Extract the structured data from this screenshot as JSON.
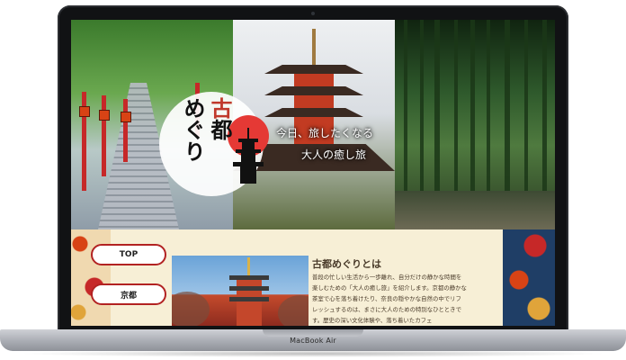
{
  "device": {
    "brand": "MacBook Air"
  },
  "hero": {
    "logo_text": {
      "line1_red": "古",
      "line1": "都",
      "line2": "めぐり"
    },
    "tagline": {
      "line1": "今日、旅したくなる",
      "line2": "大人の癒し旅"
    }
  },
  "nav": {
    "items": [
      {
        "label": "TOP"
      },
      {
        "label": "京都"
      }
    ]
  },
  "about": {
    "title": "古都めぐりとは",
    "text": "普段の忙しい生活から一歩離れ、自分だけの静かな時間を楽しむための「大人の癒し旅」を紹介します。京都の静かな茶室で心を落ち着けたり、奈良の穏やかな自然の中でリフレッシュするのは、まさに大人のための特別なひとときです。歴史の深い文化体験や、落ち着いたカフェ"
  },
  "colors": {
    "accent_red": "#c0392b",
    "nav_border": "#b22222",
    "text": "#4a3b2a"
  }
}
